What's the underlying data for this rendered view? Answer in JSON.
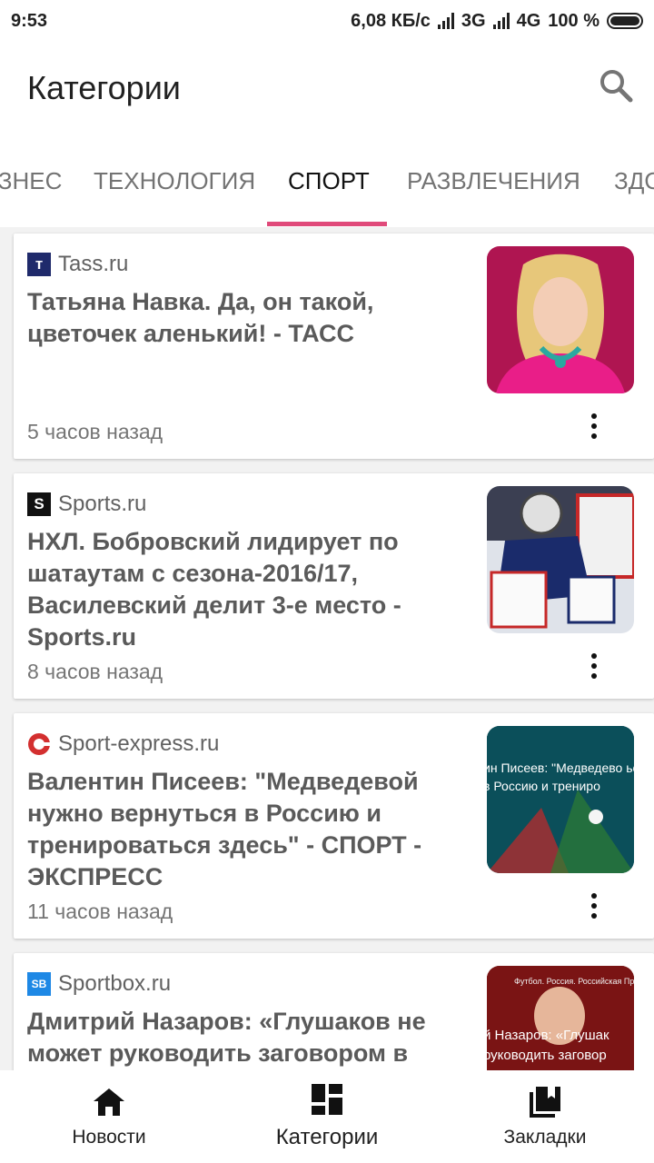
{
  "status_bar": {
    "time": "9:53",
    "network_speed": "6,08 КБ/с",
    "network1": "3G",
    "network2": "4G",
    "battery": "100 %"
  },
  "app_bar": {
    "title": "Категории",
    "search_icon": "search-icon"
  },
  "tabs": [
    {
      "label": "БИЗНЕС",
      "active": false
    },
    {
      "label": "ТЕХНОЛОГИЯ",
      "active": false
    },
    {
      "label": "СПОРТ",
      "active": true
    },
    {
      "label": "РАЗВЛЕЧЕНИЯ",
      "active": false
    },
    {
      "label": "ЗДОРОВЬЕ",
      "active": false
    }
  ],
  "accent_color": "#e04a7a",
  "articles": [
    {
      "source": "Tass.ru",
      "headline": "Татьяна Навка. Да, он такой, цветочек аленький! - ТАСС",
      "time": "5 часов назад"
    },
    {
      "source": "Sports.ru",
      "headline": "НХЛ. Бобровский лидирует по шатаутам с сезона-2016/17, Василевский делит 3-е место - Sports.ru",
      "time": "8 часов назад"
    },
    {
      "source": "Sport-express.ru",
      "headline": "Валентин Писеев: \"Медведевой нужно вернуться в Россию и тренироваться здесь\" - СПОРТ - ЭКСПРЕСС",
      "time": "11 часов назад",
      "thumb_text": "ин Писеев: \"Медведево ься в Россию и трениро"
    },
    {
      "source": "Sportbox.ru",
      "headline": "Дмитрий Назаров: «Глушаков не может руководить заговором в",
      "time": "",
      "thumb_caption": "Футбол. Россия. Российская Прем",
      "thumb_text": "й Назаров: «Глушак руководить заговор"
    }
  ],
  "bottom_nav": [
    {
      "label": "Новости",
      "icon": "home-icon",
      "active": false
    },
    {
      "label": "Категории",
      "icon": "dashboard-icon",
      "active": true
    },
    {
      "label": "Закладки",
      "icon": "bookmarks-icon",
      "active": false
    }
  ]
}
